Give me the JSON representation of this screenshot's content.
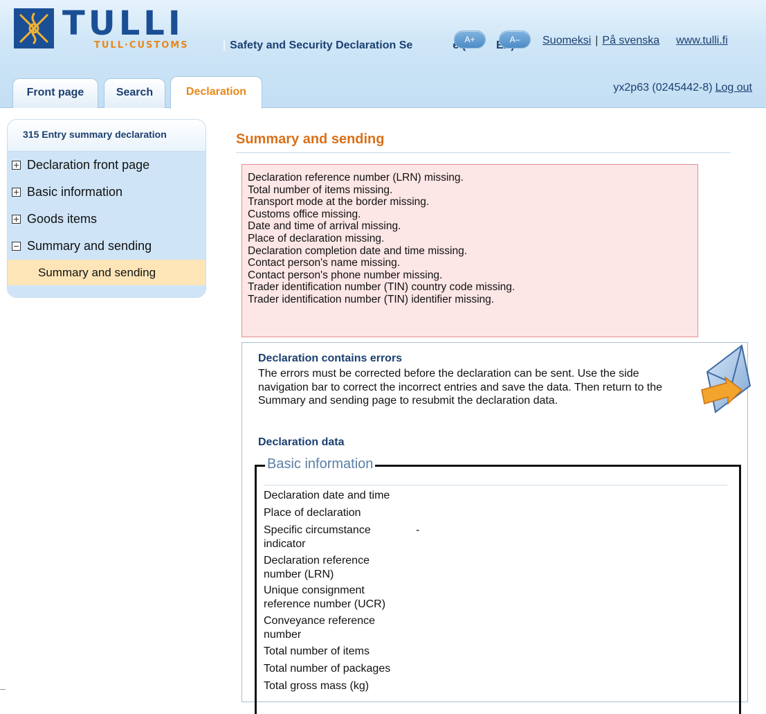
{
  "header": {
    "logo_word": "TULLI",
    "logo_sub": "TULL·CUSTOMS",
    "service_separator": "|",
    "service_name": "Safety and Security Declaration Se",
    "service_name_tail": "e (",
    "service_name_end": "EX)",
    "font_increase": "A+",
    "font_decrease": "A–",
    "lang_finnish": "Suomeksi",
    "lang_separator": "|",
    "lang_swedish": "På svenska",
    "site_link": "www.tulli.fi",
    "user_id": "yx2p63 (0245442-8)",
    "logout": "Log out"
  },
  "tabs": [
    {
      "label": "Front page"
    },
    {
      "label": "Search"
    },
    {
      "label": "Declaration"
    }
  ],
  "nav": {
    "title": "315 Entry summary declaration",
    "items": [
      {
        "label": "Declaration front page",
        "expander": "plus"
      },
      {
        "label": "Basic information",
        "expander": "plus"
      },
      {
        "label": "Goods items",
        "expander": "plus"
      },
      {
        "label": "Summary and sending",
        "expander": "minus"
      }
    ],
    "sub_selected": "Summary and sending"
  },
  "main": {
    "title": "Summary and sending",
    "errors": [
      "Declaration reference number (LRN) missing.",
      "Total number of items missing.",
      "Transport mode at the border missing.",
      "Customs office missing.",
      "Date and time of arrival missing.",
      "Place of declaration missing.",
      "Declaration completion date and time missing.",
      "Contact person's name missing.",
      "Contact person's phone number missing.",
      "Trader identification number (TIN) country code missing.",
      "Trader identification number (TIN) identifier missing."
    ],
    "warning_title": "Declaration contains errors",
    "warning_lines": [
      "The errors must be corrected before the declaration can be sent. Use the side",
      "navigation bar to correct the incorrect entries and save the data. Then return to the",
      "Summary and sending page to resubmit the declaration data."
    ],
    "data_title": "Declaration data",
    "section_legend": "Basic information",
    "fields": [
      {
        "label": "Declaration date and time",
        "value": ""
      },
      {
        "label": "Place of declaration",
        "value": ""
      },
      {
        "label": "Specific circumstance indicator",
        "value": "-"
      },
      {
        "label": "Declaration reference number (LRN)",
        "value": ""
      },
      {
        "label": "Unique consignment reference number (UCR)",
        "value": ""
      },
      {
        "label": "Conveyance reference number",
        "value": ""
      },
      {
        "label": "Total number of items",
        "value": ""
      },
      {
        "label": "Total number of packages",
        "value": ""
      },
      {
        "label": "Total gross mass (kg)",
        "value": ""
      }
    ]
  },
  "colors": {
    "accent_orange": "#e8891a",
    "brand_blue": "#1b4f95",
    "error_bg": "#fde6e6",
    "nav_bg": "#cfe5f7",
    "nav_selected_bg": "#fde5b8"
  },
  "icons": [
    "tulli-logo-icon",
    "plus-box-icon",
    "minus-box-icon",
    "envelope-send-icon"
  ]
}
